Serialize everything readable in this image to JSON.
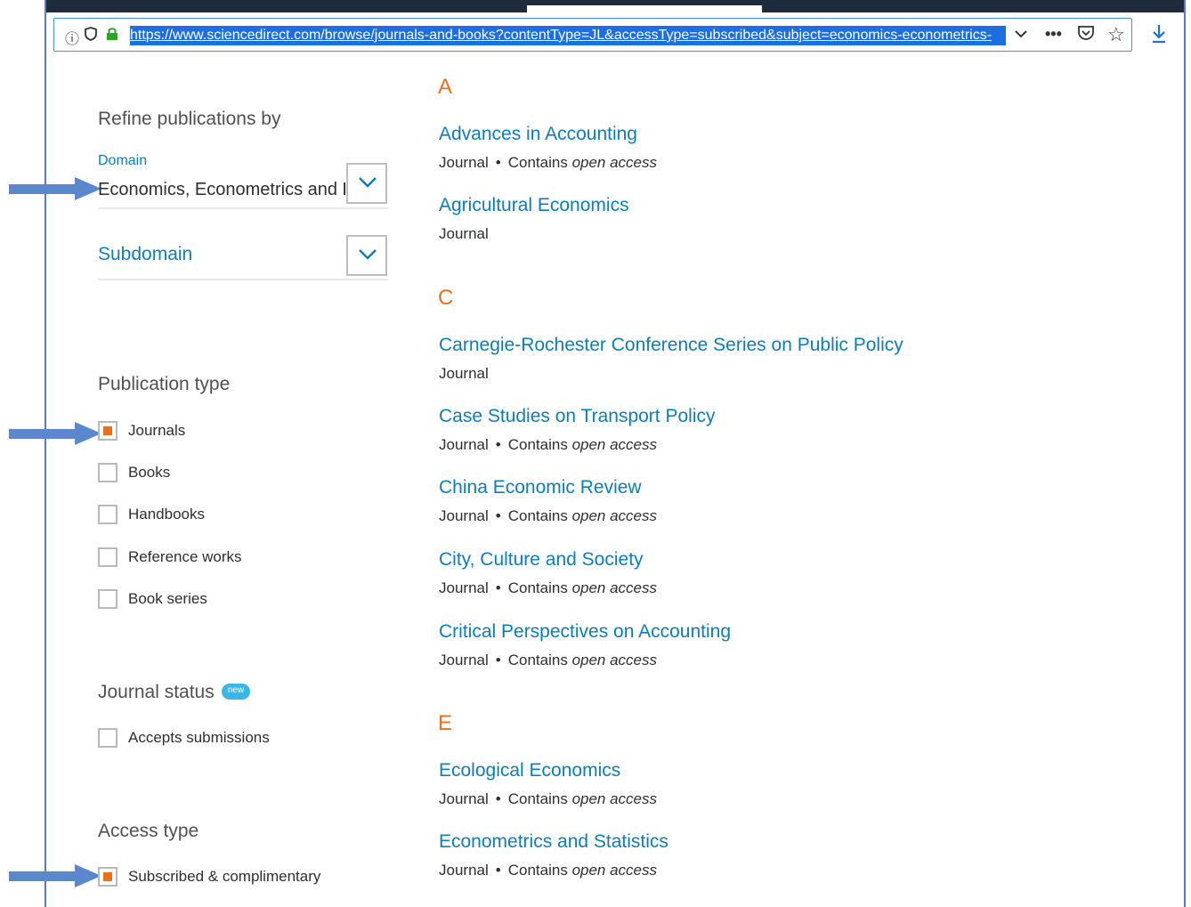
{
  "browser": {
    "url": "https://www.sciencedirect.com/browse/journals-and-books?contentType=JL&accessType=subscribed&subject=economics-econometrics-"
  },
  "sidebar": {
    "refine_heading": "Refine publications by",
    "domain_label": "Domain",
    "domain_value": "Economics, Econometrics and Finance",
    "subdomain_label": "Subdomain",
    "publication_type_heading": "Publication type",
    "publication_types": [
      {
        "label": "Journals",
        "checked": true
      },
      {
        "label": "Books",
        "checked": false
      },
      {
        "label": "Handbooks",
        "checked": false
      },
      {
        "label": "Reference works",
        "checked": false
      },
      {
        "label": "Book series",
        "checked": false
      }
    ],
    "journal_status_heading": "Journal status",
    "journal_status_badge": "new",
    "journal_status_options": [
      {
        "label": "Accepts submissions",
        "checked": false
      }
    ],
    "access_type_heading": "Access type",
    "access_type_options": [
      {
        "label": "Subscribed & complimentary",
        "checked": true
      }
    ]
  },
  "results": {
    "groups": [
      {
        "letter": "A",
        "items": [
          {
            "title": "Advances in Accounting",
            "type": "Journal",
            "open_access_prefix": "Contains",
            "open_access": "open access"
          },
          {
            "title": "Agricultural Economics",
            "type": "Journal"
          }
        ]
      },
      {
        "letter": "C",
        "items": [
          {
            "title": "Carnegie-Rochester Conference Series on Public Policy",
            "type": "Journal"
          },
          {
            "title": "Case Studies on Transport Policy",
            "type": "Journal",
            "open_access_prefix": "Contains",
            "open_access": "open access"
          },
          {
            "title": "China Economic Review",
            "type": "Journal",
            "open_access_prefix": "Contains",
            "open_access": "open access"
          },
          {
            "title": "City, Culture and Society",
            "type": "Journal",
            "open_access_prefix": "Contains",
            "open_access": "open access"
          },
          {
            "title": "Critical Perspectives on Accounting",
            "type": "Journal",
            "open_access_prefix": "Contains",
            "open_access": "open access"
          }
        ]
      },
      {
        "letter": "E",
        "items": [
          {
            "title": "Ecological Economics",
            "type": "Journal",
            "open_access_prefix": "Contains",
            "open_access": "open access"
          },
          {
            "title": "Econometrics and Statistics",
            "type": "Journal",
            "open_access_prefix": "Contains",
            "open_access": "open access"
          }
        ]
      }
    ]
  },
  "colors": {
    "accent_orange": "#e9711c",
    "link_blue": "#0c7dbb",
    "annotation_arrow": "#5b88cc"
  }
}
